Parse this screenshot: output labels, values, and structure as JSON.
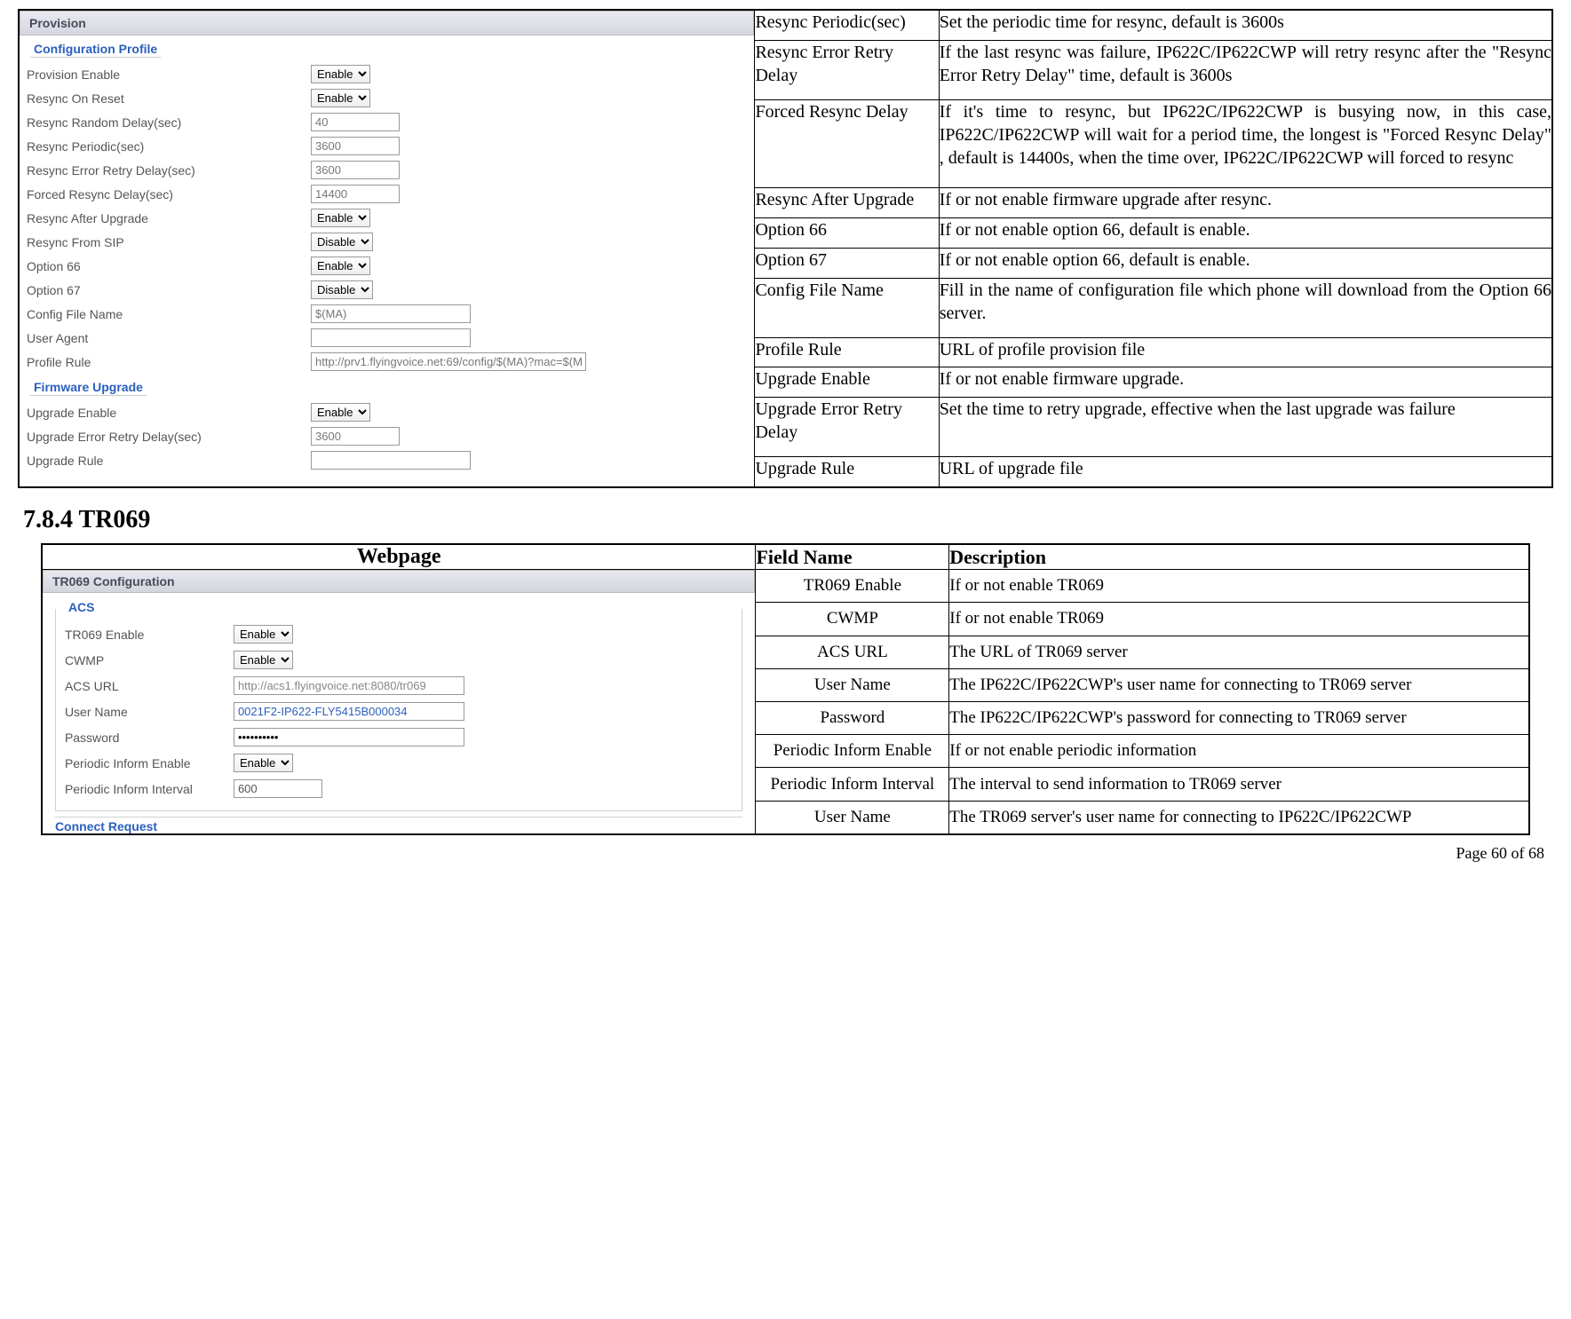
{
  "provision_panel_title": "Provision",
  "config_profile_legend": "Configuration Profile",
  "firmware_legend": "Firmware Upgrade",
  "provision_form": {
    "provision_enable": {
      "label": "Provision Enable",
      "value": "Enable"
    },
    "resync_on_reset": {
      "label": "Resync On Reset",
      "value": "Enable"
    },
    "resync_random_delay": {
      "label": "Resync Random Delay(sec)",
      "value": "40"
    },
    "resync_periodic": {
      "label": "Resync Periodic(sec)",
      "value": "3600"
    },
    "resync_error_retry": {
      "label": "Resync Error Retry Delay(sec)",
      "value": "3600"
    },
    "forced_resync_delay": {
      "label": "Forced Resync Delay(sec)",
      "value": "14400"
    },
    "resync_after_upgrade": {
      "label": "Resync After Upgrade",
      "value": "Enable"
    },
    "resync_from_sip": {
      "label": "Resync From SIP",
      "value": "Disable"
    },
    "option66": {
      "label": "Option 66",
      "value": "Enable"
    },
    "option67": {
      "label": "Option 67",
      "value": "Disable"
    },
    "config_file_name": {
      "label": "Config File Name",
      "value": "$(MA)"
    },
    "user_agent": {
      "label": "User Agent",
      "value": ""
    },
    "profile_rule": {
      "label": "Profile Rule",
      "value": "http://prv1.flyingvoice.net:69/config/$(MA)?mac=$(M"
    }
  },
  "firmware_form": {
    "upgrade_enable": {
      "label": "Upgrade Enable",
      "value": "Enable"
    },
    "upgrade_error_retry": {
      "label": "Upgrade Error Retry Delay(sec)",
      "value": "3600"
    },
    "upgrade_rule": {
      "label": "Upgrade Rule",
      "value": ""
    }
  },
  "prov_desc_rows": {
    "r0": {
      "field": "Resync Periodic(sec)",
      "desc": "Set the periodic time for resync, default is 3600s"
    },
    "r1": {
      "field": "Resync Error Retry Delay",
      "desc": "If the last resync was failure, IP622C/IP622CWP will retry resync after the \"Resync Error Retry Delay\" time, default is 3600s"
    },
    "r2": {
      "field": "Forced Resync Delay",
      "desc": "If it's time to resync, but IP622C/IP622CWP is busying now, in this case, IP622C/IP622CWP will wait for a period time, the longest is \"Forced Resync Delay\" , default is 14400s, when the time over, IP622C/IP622CWP will forced to resync"
    },
    "r3": {
      "field": "Resync After Upgrade",
      "desc": "If or not enable firmware upgrade after resync."
    },
    "r4": {
      "field": "Option 66",
      "desc": "If or not enable option 66, default is enable."
    },
    "r5": {
      "field": "Option 67",
      "desc": "If or not enable option 66, default is enable."
    },
    "r6": {
      "field": "Config File Name",
      "desc": "Fill in the name of configuration file which phone will download from the Option 66 server."
    },
    "r7": {
      "field": "Profile Rule",
      "desc": "URL of profile provision file"
    },
    "r8": {
      "field": "Upgrade Enable",
      "desc": "If or not enable firmware upgrade."
    },
    "r9": {
      "field": "Upgrade Error Retry Delay",
      "desc": "Set the time to retry upgrade, effective when the last upgrade was failure"
    },
    "r10": {
      "field": "Upgrade Rule",
      "desc": "URL of upgrade file"
    }
  },
  "section_heading": "7.8.4    TR069",
  "tr_headers": {
    "webpage": "Webpage",
    "field": "Field Name",
    "desc": "Description"
  },
  "tr_panel_title": "TR069 Configuration",
  "acs_legend": "ACS",
  "connect_request_legend": "Connect Request",
  "tr_form": {
    "tr069_enable": {
      "label": "TR069 Enable",
      "value": "Enable"
    },
    "cwmp": {
      "label": "CWMP",
      "value": "Enable"
    },
    "acs_url": {
      "label": "ACS URL",
      "value": "http://acs1.flyingvoice.net:8080/tr069"
    },
    "username": {
      "label": "User Name",
      "value": "0021F2-IP622-FLY5415B000034"
    },
    "password": {
      "label": "Password",
      "value": "••••••••••"
    },
    "periodic_enable": {
      "label": "Periodic Inform Enable",
      "value": "Enable"
    },
    "periodic_interval": {
      "label": "Periodic Inform Interval",
      "value": "600"
    }
  },
  "tr_desc_rows": {
    "r0": {
      "field": "TR069 Enable",
      "desc": "If or not enable TR069"
    },
    "r1": {
      "field": "CWMP",
      "desc": "If   or not enable TR069"
    },
    "r2": {
      "field": "ACS URL",
      "desc": "The URL of TR069 server"
    },
    "r3": {
      "field": "User Name",
      "desc": "The IP622C/IP622CWP's user name for connecting to TR069 server"
    },
    "r4": {
      "field": "Password",
      "desc": "The IP622C/IP622CWP's password for connecting to TR069 server"
    },
    "r5": {
      "field": "Periodic Inform Enable",
      "desc": "If or not enable periodic information"
    },
    "r6": {
      "field": "Periodic Inform Interval",
      "desc": "The interval to send information to TR069 server"
    },
    "r7": {
      "field": "User Name",
      "desc": "The TR069 server's user name for connecting to IP622C/IP622CWP"
    }
  },
  "page_footer": "Page 60 of 68"
}
